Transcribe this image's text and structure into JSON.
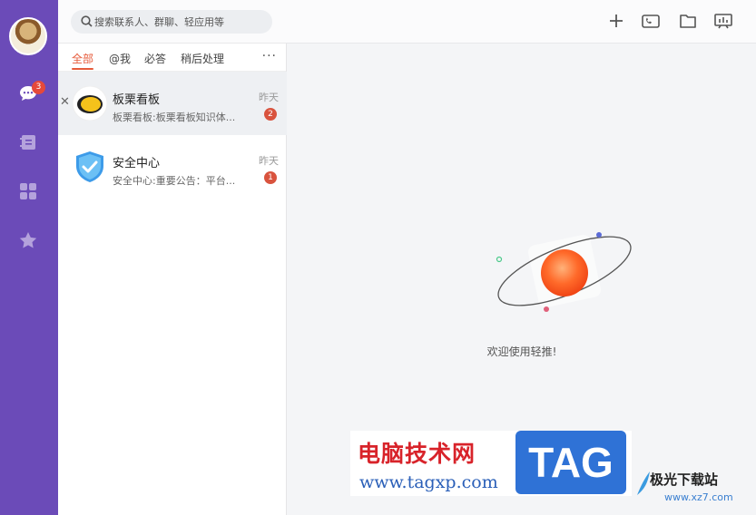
{
  "nav": {
    "unread_badge": "3",
    "items": [
      {
        "name": "chat-icon"
      },
      {
        "name": "contacts-icon"
      },
      {
        "name": "apps-grid-icon"
      },
      {
        "name": "star-icon"
      }
    ]
  },
  "search": {
    "placeholder": "搜索联系人、群聊、轻应用等"
  },
  "toolbar": {
    "icons": [
      "plus-icon",
      "video-call-icon",
      "folder-icon",
      "presentation-icon"
    ]
  },
  "tabs": [
    {
      "label": "全部",
      "active": true
    },
    {
      "label": "@我"
    },
    {
      "label": "必答"
    },
    {
      "label": "稍后处理"
    }
  ],
  "tabs_more": "···",
  "conversations": [
    {
      "name": "板栗看板",
      "preview": "板栗看板:板栗看板知识体...",
      "time": "昨天",
      "unread": "2",
      "selected": true
    },
    {
      "name": "安全中心",
      "preview": "安全中心:重要公告：平台...",
      "time": "昨天",
      "unread": "1"
    }
  ],
  "main": {
    "welcome": "欢迎使用轻推!"
  },
  "watermark": {
    "site_cn": "电脑技术网",
    "url": "www.tagxp.com",
    "tag": "TAG",
    "site2_cn": "极光下载站",
    "site2_url": "www.xz7.com"
  },
  "colors": {
    "rail": "#6b4bb8",
    "accent": "#e65a3a",
    "badge": "#e5493a"
  }
}
